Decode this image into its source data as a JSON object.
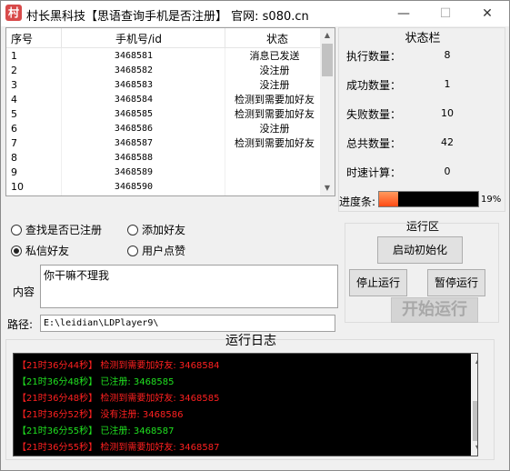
{
  "window": {
    "app_icon_glyph": "村",
    "title": "村长黑科技【思语查询手机是否注册】  官网: s080.cn",
    "min_glyph": "—",
    "max_glyph": "☐",
    "close_glyph": "✕"
  },
  "table": {
    "headers": [
      "序号",
      "手机号/id",
      "状态"
    ],
    "rows": [
      {
        "idx": "1",
        "id": "3468581",
        "status": "消息已发送"
      },
      {
        "idx": "2",
        "id": "3468582",
        "status": "没注册"
      },
      {
        "idx": "3",
        "id": "3468583",
        "status": "没注册"
      },
      {
        "idx": "4",
        "id": "3468584",
        "status": "检测到需要加好友"
      },
      {
        "idx": "5",
        "id": "3468585",
        "status": "检测到需要加好友"
      },
      {
        "idx": "6",
        "id": "3468586",
        "status": "没注册"
      },
      {
        "idx": "7",
        "id": "3468587",
        "status": "检测到需要加好友"
      },
      {
        "idx": "8",
        "id": "3468588",
        "status": ""
      },
      {
        "idx": "9",
        "id": "3468589",
        "status": ""
      },
      {
        "idx": "10",
        "id": "3468590",
        "status": ""
      }
    ]
  },
  "status": {
    "title": "状态栏",
    "stats": [
      {
        "label": "执行数量：",
        "value": "8"
      },
      {
        "label": "成功数量：",
        "value": "1"
      },
      {
        "label": "失败数量：",
        "value": "10"
      },
      {
        "label": "总共数量：",
        "value": "42"
      },
      {
        "label": "时速计算：",
        "value": "0"
      }
    ],
    "progress_label": "进度条:",
    "progress_percent": "19%",
    "progress_fraction": 0.19
  },
  "options": {
    "check_registered": "查找是否已注册",
    "add_friend": "添加好友",
    "dm_friend": "私信好友",
    "like_user": "用户点赞"
  },
  "content": {
    "label": "内容",
    "value": "你干嘛不理我"
  },
  "path": {
    "label": "路径:",
    "value": "E:\\leidian\\LDPlayer9\\"
  },
  "run": {
    "title": "运行区",
    "init": "启动初始化",
    "stop": "停止运行",
    "pause": "暂停运行",
    "start": "开始运行"
  },
  "log": {
    "title": "运行日志",
    "colors": {
      "red": "#ff2020",
      "green": "#20e020"
    },
    "lines": [
      {
        "text": "【21时36分44秒】 检测到需要加好友: 3468584",
        "color": "red"
      },
      {
        "text": "【21时36分48秒】 已注册: 3468585",
        "color": "green"
      },
      {
        "text": "【21时36分48秒】 检测到需要加好友: 3468585",
        "color": "red"
      },
      {
        "text": "【21时36分52秒】 没有注册: 3468586",
        "color": "red"
      },
      {
        "text": "【21时36分55秒】 已注册: 3468587",
        "color": "green"
      },
      {
        "text": "【21时36分55秒】 检测到需要加好友: 3468587",
        "color": "red"
      }
    ]
  },
  "glyphs": {
    "up": "▲",
    "down": "▼"
  }
}
